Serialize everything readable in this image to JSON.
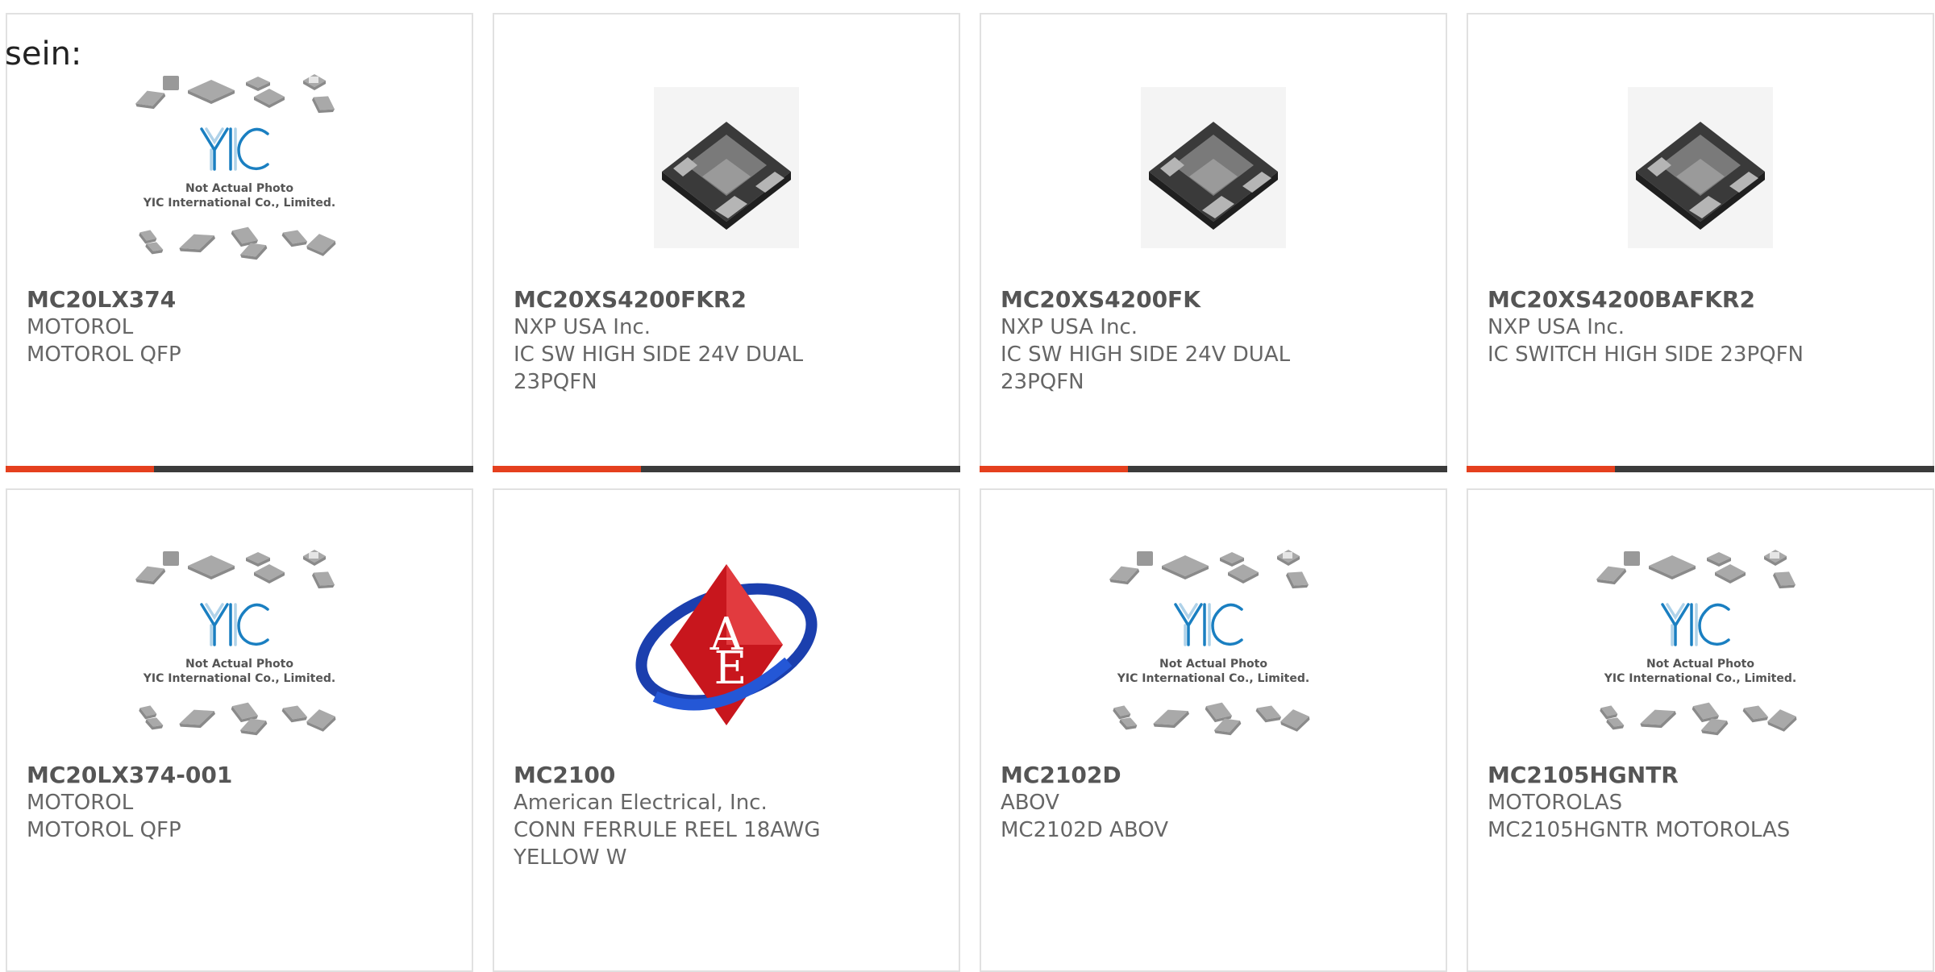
{
  "page": {
    "heading": "sein:"
  },
  "placeholder_text": {
    "line1": "Not Actual Photo",
    "line2": "YIC International Co., Limited.",
    "logo": "YIC"
  },
  "products": [
    {
      "part_number": "MC20LX374",
      "manufacturer": "MOTOROL",
      "description": "MOTOROL QFP",
      "image": "yic-placeholder"
    },
    {
      "part_number": "MC20XS4200FKR2",
      "manufacturer": "NXP USA Inc.",
      "description": "IC SW HIGH SIDE 24V DUAL 23PQFN",
      "image": "qfn-chip"
    },
    {
      "part_number": "MC20XS4200FK",
      "manufacturer": "NXP USA Inc.",
      "description": "IC SW HIGH SIDE 24V DUAL 23PQFN",
      "image": "qfn-chip"
    },
    {
      "part_number": "MC20XS4200BAFKR2",
      "manufacturer": "NXP USA Inc.",
      "description": "IC SWITCH HIGH SIDE 23PQFN",
      "image": "qfn-chip"
    },
    {
      "part_number": "MC20LX374-001",
      "manufacturer": "MOTOROL",
      "description": "MOTOROL QFP",
      "image": "yic-placeholder"
    },
    {
      "part_number": "MC2100",
      "manufacturer": "American Electrical, Inc.",
      "description": "CONN FERRULE REEL 18AWG YELLOW W",
      "image": "ae-logo",
      "logo_text": "AE"
    },
    {
      "part_number": "MC2102D",
      "manufacturer": "ABOV",
      "description": "MC2102D ABOV",
      "image": "yic-placeholder"
    },
    {
      "part_number": "MC2105HGNTR",
      "manufacturer": "MOTOROLAS",
      "description": "MC2105HGNTR MOTOROLAS",
      "image": "yic-placeholder"
    }
  ],
  "colors": {
    "accent": "#e5401e",
    "bar": "#3b3b3b",
    "border": "#e1e1e1",
    "logo_blue": "#1a7fc1"
  }
}
